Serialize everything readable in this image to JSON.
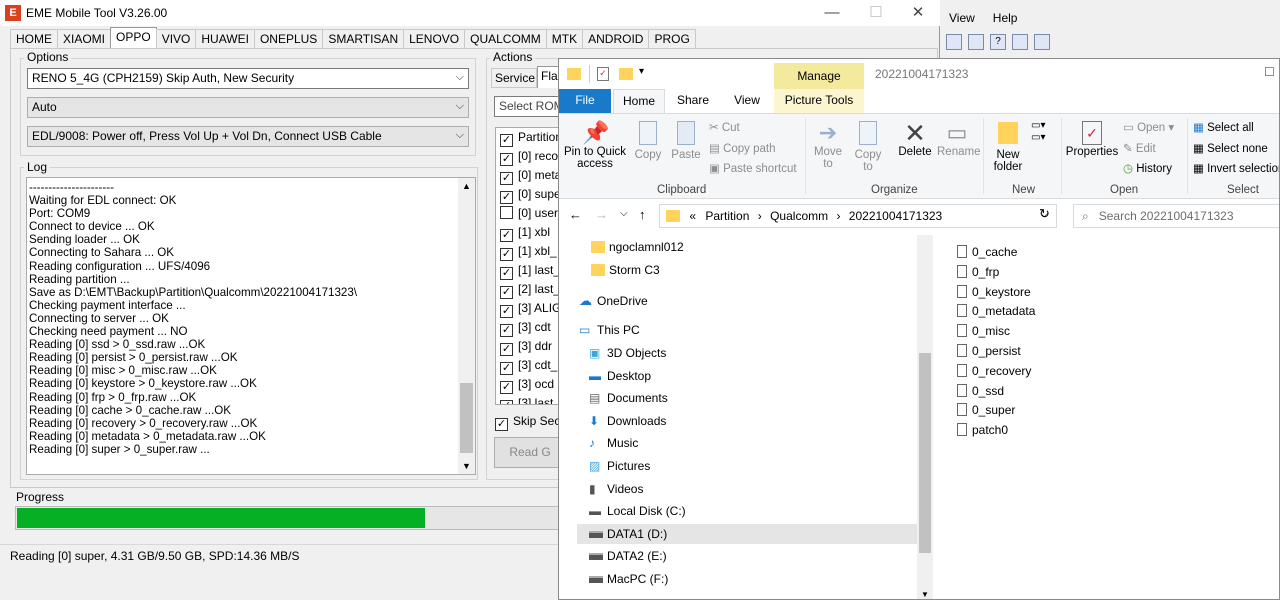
{
  "bg_window": {
    "menu": [
      "View",
      "Help"
    ]
  },
  "eme": {
    "title": "EME Mobile Tool V3.26.00",
    "logo_letter": "E",
    "tabs": [
      "HOME",
      "XIAOMI",
      "OPPO",
      "VIVO",
      "HUAWEI",
      "ONEPLUS",
      "SMARTISAN",
      "LENOVO",
      "QUALCOMM",
      "MTK",
      "ANDROID",
      "PROG"
    ],
    "active_tab": "OPPO",
    "options": {
      "label": "Options",
      "model": "RENO 5_4G (CPH2159) Skip Auth, New Security",
      "mode": "Auto",
      "connect": "EDL/9008: Power off, Press Vol Up + Vol Dn, Connect USB Cable"
    },
    "log": {
      "label": "Log",
      "lines": [
        "----------------------",
        "Waiting for EDL connect: OK",
        "Port: COM9",
        "Connect to device ... OK",
        "Sending loader ... OK",
        "Connecting to Sahara ... OK",
        "Reading configuration ... UFS/4096",
        "Reading partition ...",
        "Save as D:\\EMT\\Backup\\Partition\\Qualcomm\\20221004171323\\",
        "Checking payment interface ...",
        "Connecting to server ... OK",
        "Checking need payment ... NO",
        "Reading [0] ssd > 0_ssd.raw ...OK",
        "Reading [0] persist > 0_persist.raw ...OK",
        "Reading [0] misc > 0_misc.raw ...OK",
        "Reading [0] keystore > 0_keystore.raw ...OK",
        "Reading [0] frp > 0_frp.raw ...OK",
        "Reading [0] cache > 0_cache.raw ...OK",
        "Reading [0] recovery > 0_recovery.raw ...OK",
        "Reading [0] metadata > 0_metadata.raw ...OK",
        "Reading [0] super > 0_super.raw ..."
      ]
    },
    "actions": {
      "label": "Actions",
      "tabs": [
        "Service",
        "Flas"
      ],
      "select_rom": "Select ROM",
      "partition_header": "Partition",
      "partitions": [
        {
          "label": "[0] reco",
          "checked": true
        },
        {
          "label": "[0] meta",
          "checked": true
        },
        {
          "label": "[0] supe",
          "checked": true
        },
        {
          "label": "[0] user",
          "checked": false
        },
        {
          "label": "[1] xbl",
          "checked": true
        },
        {
          "label": "[1] xbl_",
          "checked": true
        },
        {
          "label": "[1] last_",
          "checked": true
        },
        {
          "label": "[2] last_",
          "checked": true
        },
        {
          "label": "[3] ALIG",
          "checked": true
        },
        {
          "label": "[3] cdt",
          "checked": true
        },
        {
          "label": "[3] ddr",
          "checked": true
        },
        {
          "label": "[3] cdt_",
          "checked": true
        },
        {
          "label": "[3] ocd",
          "checked": true
        },
        {
          "label": "[3] last",
          "checked": true
        }
      ],
      "skip_security": "Skip Secu",
      "read_button": "Read G"
    },
    "progress": {
      "label": "Progress",
      "percent": 44.4
    },
    "status": "Reading [0] super, 4.31 GB/9.50 GB, SPD:14.36 MB/S",
    "colors": {
      "progress": "#06b025",
      "logo": "#d94022"
    }
  },
  "explorer": {
    "title": "20221004171323",
    "manage": "Manage",
    "ribbon_tabs": [
      "File",
      "Home",
      "Share",
      "View",
      "Picture Tools"
    ],
    "clipboard": {
      "label": "Clipboard",
      "pin": "Pin to Quick access",
      "copy": "Copy",
      "paste": "Paste",
      "cut": "Cut",
      "copy_path": "Copy path",
      "paste_shortcut": "Paste shortcut"
    },
    "organize": {
      "label": "Organize",
      "move_to": "Move to",
      "copy_to": "Copy to",
      "delete": "Delete",
      "rename": "Rename"
    },
    "new": {
      "label": "New",
      "new_folder": "New folder"
    },
    "open": {
      "label": "Open",
      "properties": "Properties",
      "open": "Open",
      "edit": "Edit",
      "history": "History"
    },
    "select": {
      "label": "Select",
      "select_all": "Select all",
      "select_none": "Select none",
      "invert": "Invert selection"
    },
    "breadcrumb": [
      "«",
      "Partition",
      "Qualcomm",
      "20221004171323"
    ],
    "search_placeholder": "Search 20221004171323",
    "nav": {
      "quick": [
        "ngoclamnl012",
        "Storm C3"
      ],
      "onedrive": "OneDrive",
      "this_pc": "This PC",
      "pc_items": [
        "3D Objects",
        "Desktop",
        "Documents",
        "Downloads",
        "Music",
        "Pictures",
        "Videos",
        "Local Disk (C:)",
        "DATA1 (D:)",
        "DATA2 (E:)",
        "MacPC (F:)"
      ],
      "selected": "DATA1 (D:)"
    },
    "files": [
      "0_cache",
      "0_frp",
      "0_keystore",
      "0_metadata",
      "0_misc",
      "0_persist",
      "0_recovery",
      "0_ssd",
      "0_super",
      "patch0"
    ]
  }
}
